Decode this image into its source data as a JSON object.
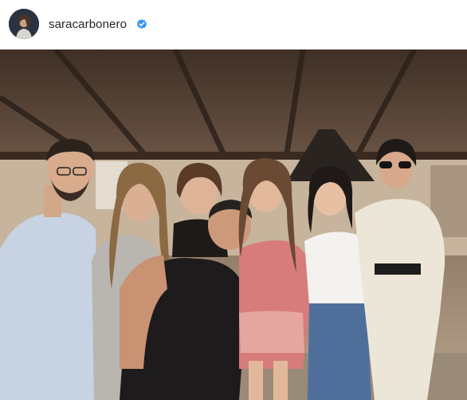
{
  "post": {
    "username": "saracarbonero",
    "verified": true,
    "avatar_icon": "profile-avatar",
    "verified_icon": "verified-badge-icon",
    "accent_color": "#3897f0"
  },
  "photo": {
    "subject_icon": "group-photo"
  }
}
